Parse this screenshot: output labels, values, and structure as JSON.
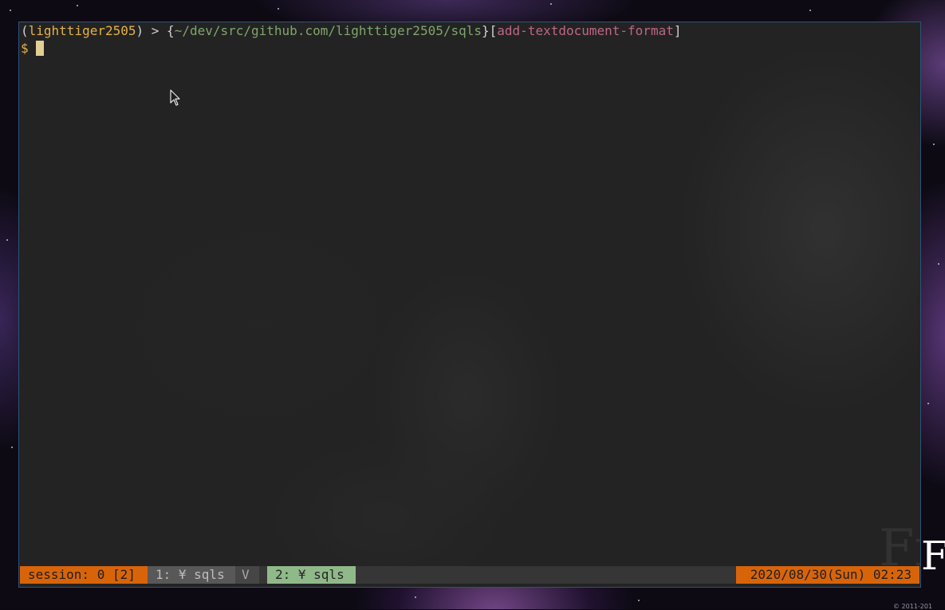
{
  "desktop": {
    "wallpaper_text": "Fre",
    "copyright": "© 2011-201"
  },
  "terminal": {
    "prompt_line": {
      "open_paren": "(",
      "user": "lighttiger2505",
      "close_paren": ")",
      "separator": " > ",
      "open_brace": "{",
      "path": "~/dev/src/github.com/lighttiger2505/sqls",
      "close_brace": "}",
      "open_bracket": "[",
      "branch": "add-textdocument-format",
      "close_bracket": "]"
    },
    "input_line": {
      "prompt_symbol": "$",
      "value": ""
    }
  },
  "statusbar": {
    "session": "session: 0 [2]",
    "window1": "1: ¥ sqls",
    "separator_icon": "V",
    "window2": "2: ¥ sqls",
    "clock": "2020/08/30(Sun) 02:23"
  },
  "colors": {
    "terminal_bg": "#232323",
    "user": "#e5b24a",
    "path": "#7fa56b",
    "branch": "#c06587",
    "status_accent": "#d8640a",
    "active_window": "#90b98a"
  },
  "icons": [
    "mouse-pointer-icon",
    "git-branch-icon",
    "cursor-block"
  ]
}
